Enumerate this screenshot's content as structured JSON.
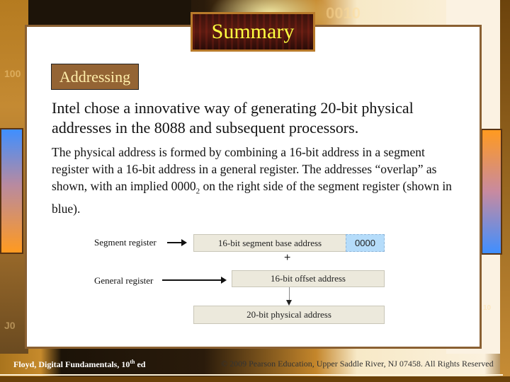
{
  "slide": {
    "title": "Summary",
    "section_tag": "Addressing",
    "intro": "Intel chose a innovative way of generating 20-bit physical addresses in the 8088 and subsequent processors.",
    "body": {
      "part1": "The physical address is formed by combining a 16-bit address in a segment register with a 16-bit address in a general register. The addresses “overlap” as shown, with an implied 0000",
      "subscript": "2",
      "part2": " on the right side of the segment register (shown in blue)."
    }
  },
  "diagram": {
    "segment_label": "Segment register",
    "general_label": "General register",
    "segment_box": "16-bit segment base address",
    "implied_zeros": "0000",
    "operator": "+",
    "offset_box": "16-bit offset address",
    "result_box": "20-bit physical address",
    "colors": {
      "register_fill": "#ece9dc",
      "zeros_fill": "#b5dcfa"
    }
  },
  "background": {
    "digits": [
      "0010",
      "100",
      "J0",
      "10"
    ]
  },
  "footer": {
    "book": "Floyd, Digital Fundamentals, 10",
    "edition_sup": "th",
    "edition_suffix": " ed",
    "copyright": "© 2009 Pearson Education, Upper Saddle River, NJ 07458. All Rights Reserved"
  },
  "colors": {
    "title_text": "#ffff40",
    "tag_fill": "#946434",
    "tag_text": "#ffeeaa",
    "panel_border": "#8a6032"
  }
}
